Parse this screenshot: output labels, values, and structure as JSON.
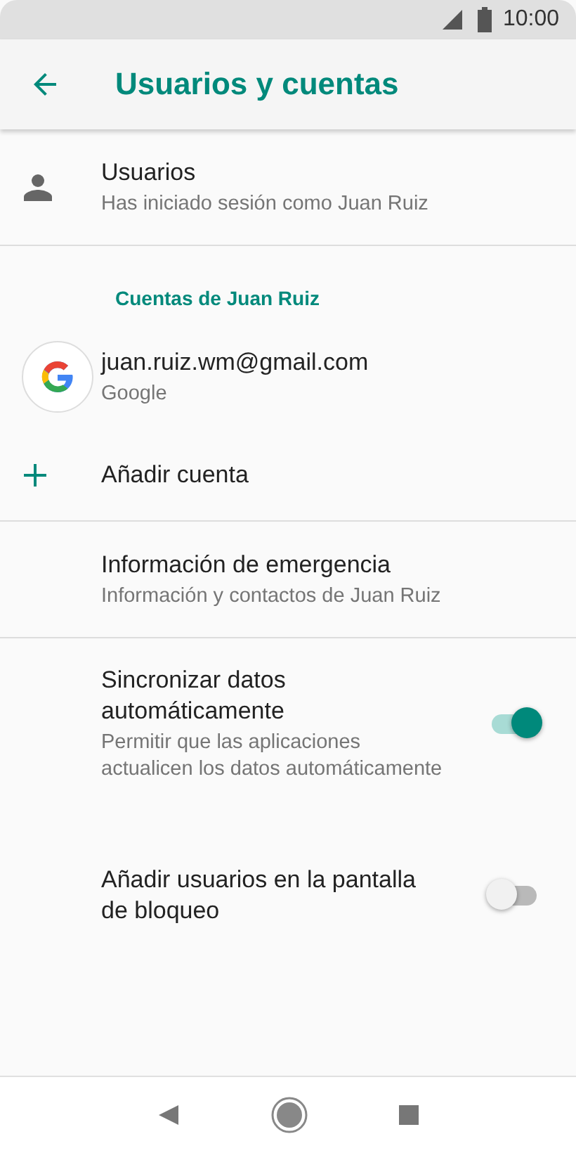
{
  "status_bar": {
    "time": "10:00"
  },
  "app_bar": {
    "title": "Usuarios y cuentas"
  },
  "sections": [
    {
      "items": [
        {
          "kind": "user",
          "title": "Usuarios",
          "subtitle": "Has iniciado sesión como Juan Ruiz"
        }
      ]
    },
    {
      "header": "Cuentas de Juan Ruiz",
      "items": [
        {
          "kind": "account",
          "title": "juan.ruiz.wm@gmail.com",
          "subtitle": "Google"
        },
        {
          "kind": "add",
          "title": "Añadir cuenta"
        }
      ]
    },
    {
      "items": [
        {
          "kind": "info",
          "title": "Información de emergencia",
          "subtitle": "Información y contactos de Juan Ruiz"
        }
      ]
    },
    {
      "items": [
        {
          "kind": "toggle",
          "title": "Sincronizar datos automáticamente",
          "subtitle": "Permitir que las aplicaciones actualicen los datos automáticamente",
          "on": true
        },
        {
          "kind": "toggle",
          "title": "Añadir usuarios en la pantalla de bloqueo",
          "on": false
        }
      ]
    }
  ]
}
